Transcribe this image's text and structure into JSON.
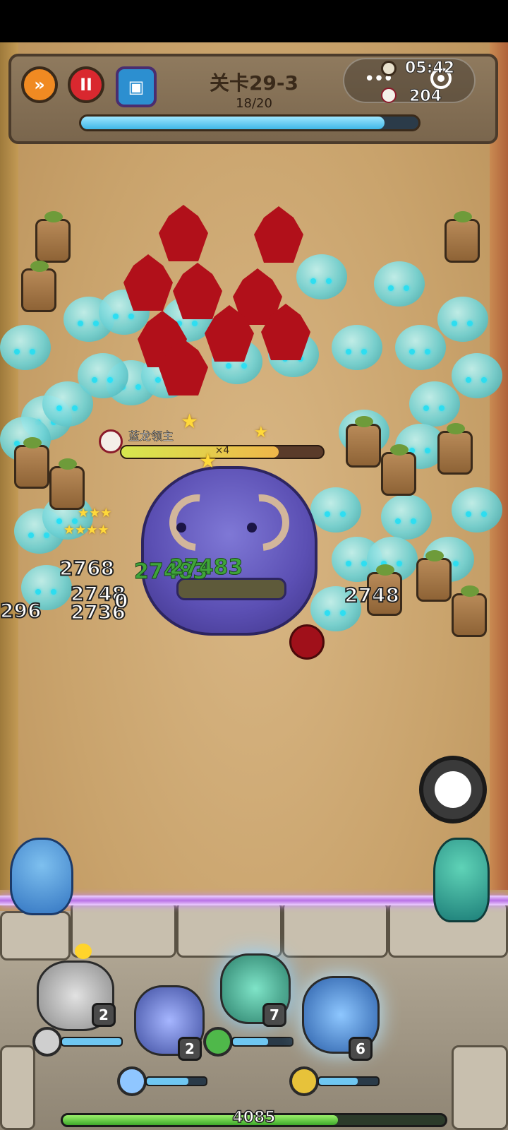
{
  "header": {
    "level_title": "关卡29-3",
    "wave_count": "18/20",
    "wave_progress": 0.9,
    "timer": "05:42",
    "kill_count": "204",
    "menu_dots": "•••"
  },
  "boss": {
    "name": "蓝龙领主",
    "multiplier": "×4",
    "hp_fraction": 0.78
  },
  "damage_numbers": {
    "d1": "2768",
    "d2": "2748",
    "d3": "2736",
    "d4": "2748",
    "d5": "296",
    "d6": "0",
    "heal1": "27483",
    "heal2": "27483"
  },
  "heroes": [
    {
      "name": "stone",
      "level": "2",
      "bar": 1.0
    },
    {
      "name": "ice",
      "level": "2",
      "bar": 0.7
    },
    {
      "name": "water",
      "level": "7",
      "bar": 0.6
    },
    {
      "name": "thunder",
      "level": "6",
      "bar": 0.65
    }
  ],
  "base": {
    "hp": "4085",
    "hp_fraction": 0.72
  },
  "colors": {
    "speed_button": "#f08a22",
    "pause_button": "#d9282f",
    "progress": "#3fb7e8",
    "boss_hp": "#f0b64a",
    "base_hp": "#3ea92b"
  }
}
